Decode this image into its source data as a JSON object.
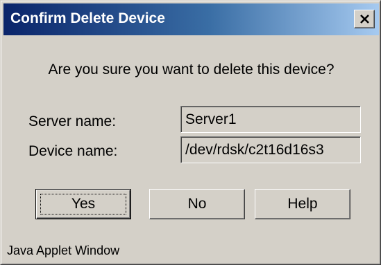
{
  "dialog": {
    "title": "Confirm Delete Device",
    "close_icon": "close-icon",
    "message": "Are you sure you want to delete this device?"
  },
  "fields": {
    "server": {
      "label": "Server name:",
      "value": "Server1"
    },
    "device": {
      "label": "Device name:",
      "value": "/dev/rdsk/c2t16d16s3"
    }
  },
  "buttons": {
    "yes": "Yes",
    "no": "No",
    "help": "Help"
  },
  "status": {
    "text": "Java Applet Window"
  },
  "colors": {
    "titlebar_start": "#0a246a",
    "titlebar_end": "#a6caf0",
    "face": "#d4d0c8"
  }
}
